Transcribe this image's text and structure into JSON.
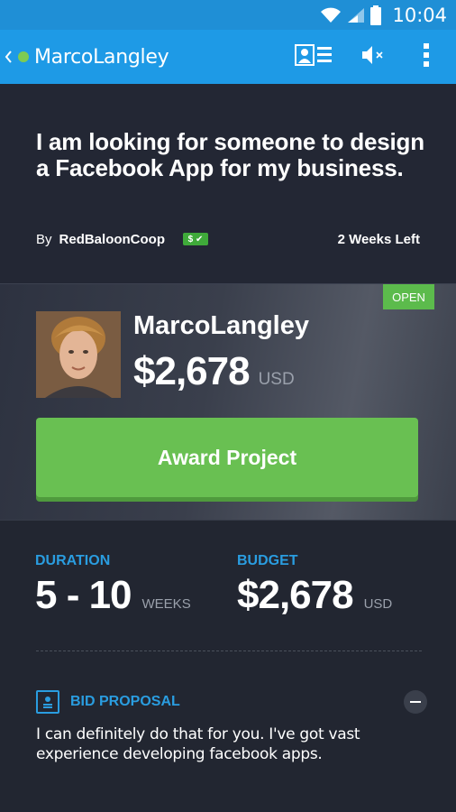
{
  "status_bar": {
    "time": "10:04",
    "icons": [
      "wifi-icon",
      "signal-icon",
      "battery-icon"
    ]
  },
  "action_bar": {
    "title": "MarcoLangley",
    "online_status_color": "#7ecb52",
    "actions": [
      "profile-card-icon",
      "mute-icon",
      "overflow-menu-icon"
    ]
  },
  "project": {
    "title": "I am looking for someone to design a Facebook App for my business.",
    "by_label": "By",
    "owner": "RedBaloonCoop",
    "verified_badge": "$ ✔",
    "time_left": "2 Weeks Left"
  },
  "bid": {
    "status": "OPEN",
    "bidder_name": "MarcoLangley",
    "amount": "$2,678",
    "currency": "USD",
    "award_button_label": "Award Project"
  },
  "details": {
    "duration_label": "DURATION",
    "duration_value": "5 - 10",
    "duration_unit": "WEEKS",
    "budget_label": "BUDGET",
    "budget_value": "$2,678",
    "budget_unit": "USD",
    "proposal_label": "BID PROPOSAL",
    "proposal_text": "I can definitely do that for you. I've got vast experience developing facebook apps."
  },
  "colors": {
    "accent_blue": "#2a9de0",
    "action_bar": "#1e9ae6",
    "award_green": "#69c052",
    "open_green": "#5cbb4c"
  }
}
